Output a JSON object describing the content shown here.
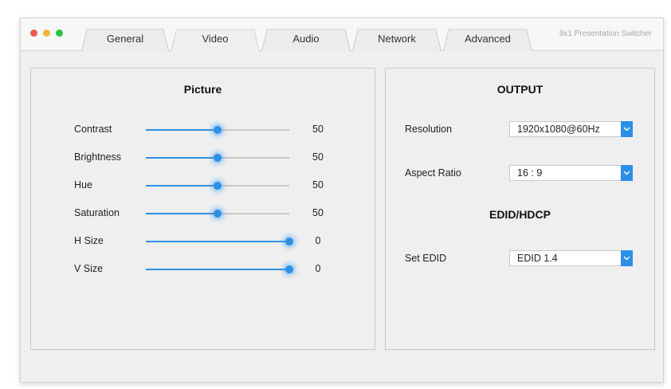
{
  "window": {
    "app_title": "9x1 Presentation Switcher",
    "tabs": [
      {
        "label": "General",
        "active": false
      },
      {
        "label": "Video",
        "active": true
      },
      {
        "label": "Audio",
        "active": false
      },
      {
        "label": "Network",
        "active": false
      },
      {
        "label": "Advanced",
        "active": false
      }
    ]
  },
  "picture": {
    "title": "Picture",
    "sliders": [
      {
        "label": "Contrast",
        "value": "50",
        "level": 0.5
      },
      {
        "label": "Brightness",
        "value": "50",
        "level": 0.5
      },
      {
        "label": "Hue",
        "value": "50",
        "level": 0.5
      },
      {
        "label": "Saturation",
        "value": "50",
        "level": 0.5
      },
      {
        "label": "H Size",
        "value": "0",
        "level": 1.0
      },
      {
        "label": "V Size",
        "value": "0",
        "level": 1.0
      }
    ]
  },
  "output": {
    "title": "OUTPUT",
    "resolution_label": "Resolution",
    "resolution_value": "1920x1080@60Hz",
    "aspect_label": "Aspect Ratio",
    "aspect_value": "16 : 9"
  },
  "edid": {
    "title": "EDID/HDCP",
    "set_label": "Set EDID",
    "set_value": "EDID 1.4"
  },
  "colors": {
    "accent": "#2f8fe0",
    "dropdown_button": "#2b8fe8"
  }
}
